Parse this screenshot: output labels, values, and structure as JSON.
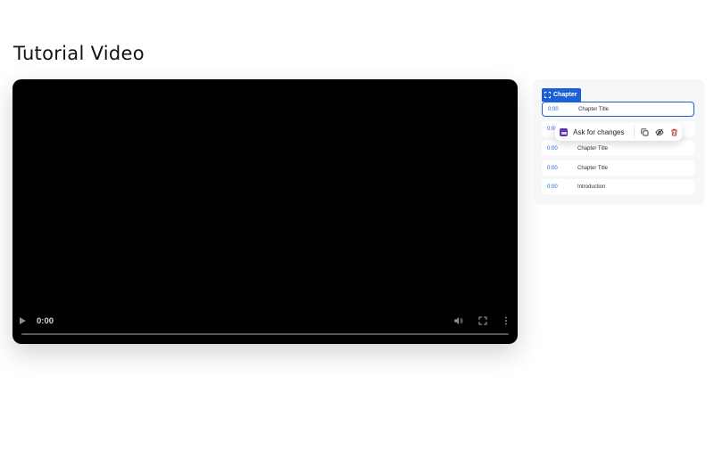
{
  "page": {
    "title": "Tutorial Video"
  },
  "video": {
    "current_time": "0:00",
    "progress": 0
  },
  "chapters": {
    "tag_label": "Chapter",
    "items": [
      {
        "time": "0:00",
        "label": "Chapter Title"
      },
      {
        "time": "0:00",
        "label": ""
      },
      {
        "time": "0:00",
        "label": "Chapter Title"
      },
      {
        "time": "0:00",
        "label": "Chapter Title"
      },
      {
        "time": "0:00",
        "label": "Introduction"
      }
    ]
  },
  "popover": {
    "ask_label": "Ask for changes"
  },
  "colors": {
    "accent": "#1c5fd6",
    "delete": "#c0392b",
    "ai": "#5b3aa8"
  }
}
